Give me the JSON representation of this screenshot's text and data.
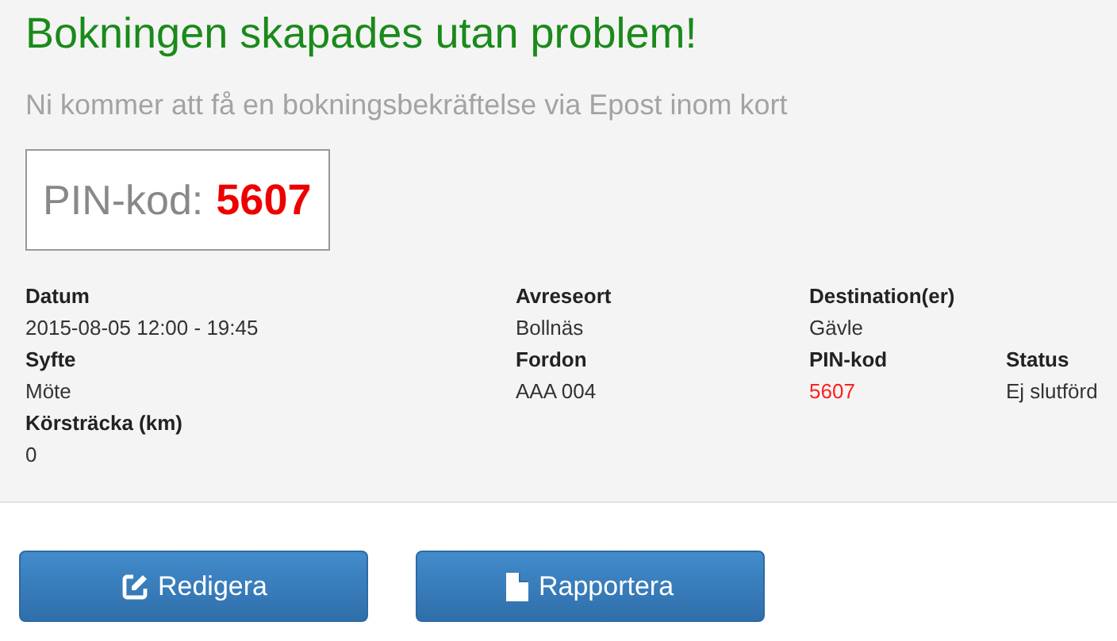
{
  "heading": "Bokningen skapades utan problem!",
  "subtitle": "Ni kommer att få en bokningsbekräftelse via Epost inom kort",
  "pin_box": {
    "label": "PIN-kod:",
    "value": "5607"
  },
  "details": [
    [
      {
        "label": "Datum",
        "value": "2015-08-05 12:00 - 19:45",
        "highlight": false
      },
      {
        "label": "Avreseort",
        "value": "Bollnäs",
        "highlight": false
      },
      {
        "label": "Destination(er)",
        "value": "Gävle",
        "highlight": false
      }
    ],
    [
      {
        "label": "Syfte",
        "value": "Möte",
        "highlight": false
      },
      {
        "label": "Fordon",
        "value": "AAA 004",
        "highlight": false
      },
      {
        "label": "PIN-kod",
        "value": "5607",
        "highlight": true
      },
      {
        "label": "Status",
        "value": "Ej slutförd",
        "highlight": false
      }
    ],
    [
      {
        "label": "Körsträcka (km)",
        "value": "0",
        "highlight": false
      }
    ]
  ],
  "buttons": [
    {
      "kind": "edit",
      "label": "Redigera"
    },
    {
      "kind": "document",
      "label": "Rapportera"
    }
  ]
}
